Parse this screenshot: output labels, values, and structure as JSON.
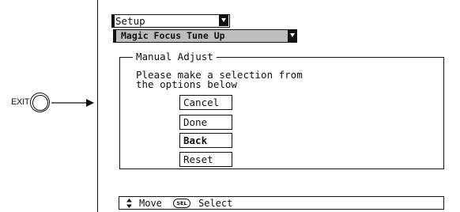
{
  "remote": {
    "exit_label": "EXIT"
  },
  "menu": {
    "setup_label": "Setup",
    "submenu_label": "Magic Focus Tune Up"
  },
  "manual_adjust": {
    "title": "Manual Adjust",
    "prompt_line1": "Please make a selection from",
    "prompt_line2": "the options below",
    "options": [
      "Cancel",
      "Done",
      "Back",
      "Reset"
    ],
    "selected_option": "Back"
  },
  "help_bar": {
    "move_icon": "up-down-arrows-icon",
    "move_label": "Move",
    "select_icon": "sel-button-icon",
    "select_icon_text": "SEL",
    "select_label": "Select"
  }
}
